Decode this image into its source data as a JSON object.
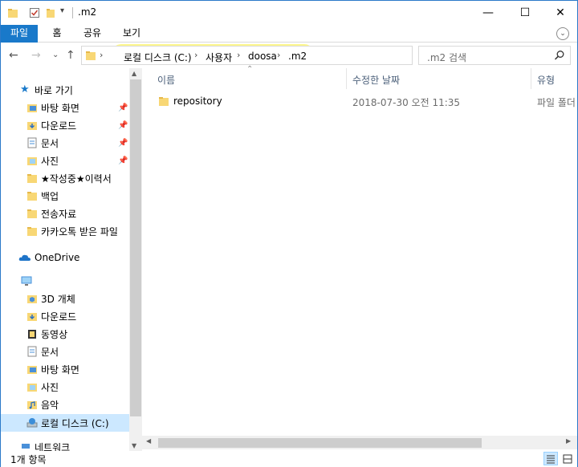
{
  "window": {
    "title": ".m2",
    "minimize": "—",
    "maximize": "☐",
    "close": "✕"
  },
  "ribbon": {
    "tabs": [
      "파일",
      "홈",
      "공유",
      "보기"
    ]
  },
  "address": {
    "crumbs": [
      "로컬 디스크 (C:)",
      "사용자",
      "doosa",
      ".m2"
    ],
    "search_placeholder": ".m2 검색"
  },
  "nav": {
    "quick_access": "바로 가기",
    "pinned": [
      "바탕 화면",
      "다운로드",
      "문서",
      "사진"
    ],
    "folders": [
      "★작성중★이력서",
      "백업",
      "전송자료",
      "카카오톡 받은 파일"
    ],
    "onedrive": "OneDrive",
    "this_pc_items": [
      "3D 개체",
      "다운로드",
      "동영상",
      "문서",
      "바탕 화면",
      "사진",
      "음악",
      "로컬 디스크 (C:)"
    ],
    "network": "네트워크"
  },
  "columns": {
    "name": "이름",
    "modified": "수정한 날짜",
    "type": "유형"
  },
  "files": [
    {
      "name": "repository",
      "modified": "2018-07-30 오전 11:35",
      "type": "파일 폴더"
    }
  ],
  "status": {
    "count": "1개 항목"
  },
  "colors": {
    "accent": "#1979ca",
    "highlight": "#fdf586",
    "selected": "#cce8ff",
    "folder": "#f8d775"
  }
}
